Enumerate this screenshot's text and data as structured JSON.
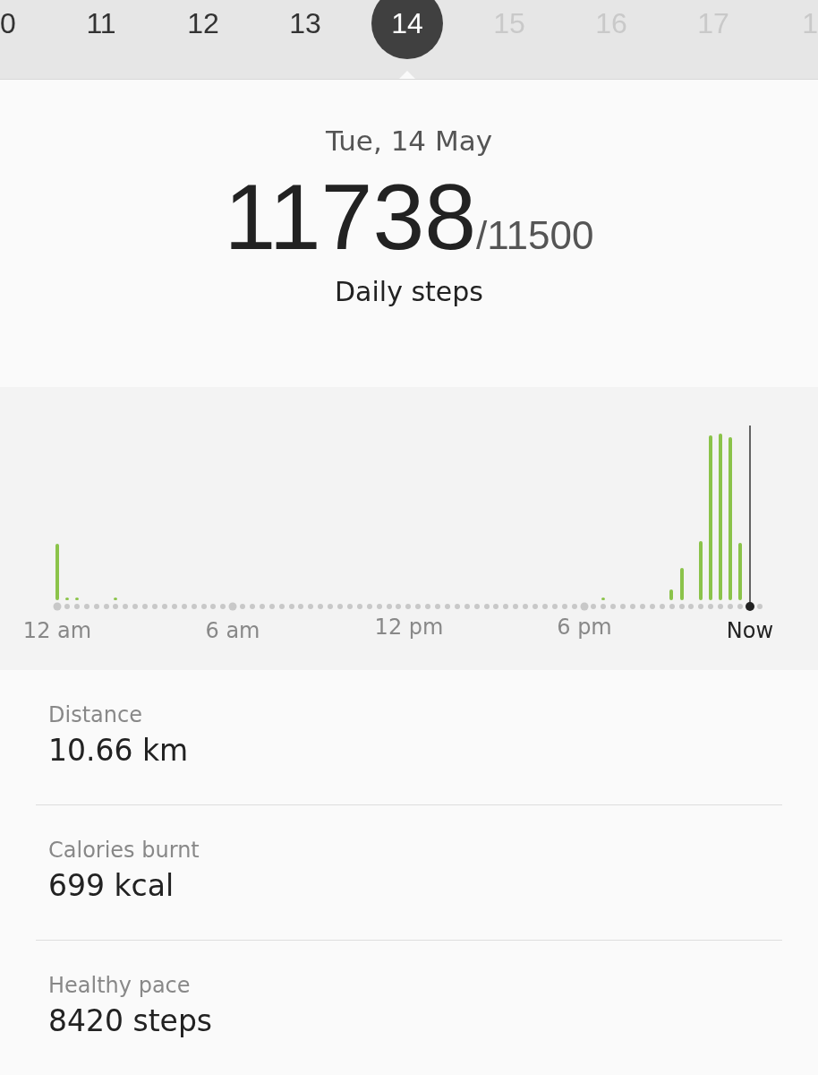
{
  "date_strip": [
    {
      "day": "0",
      "selected": false,
      "future": false
    },
    {
      "day": "11",
      "selected": false,
      "future": false
    },
    {
      "day": "12",
      "selected": false,
      "future": false
    },
    {
      "day": "13",
      "selected": false,
      "future": false
    },
    {
      "day": "14",
      "selected": true,
      "future": false
    },
    {
      "day": "15",
      "selected": false,
      "future": true
    },
    {
      "day": "16",
      "selected": false,
      "future": true
    },
    {
      "day": "17",
      "selected": false,
      "future": true
    },
    {
      "day": "1",
      "selected": false,
      "future": true
    }
  ],
  "summary": {
    "date": "Tue, 14 May",
    "steps": "11738",
    "goal": "/11500",
    "caption": "Daily steps"
  },
  "chart": {
    "axis_labels": [
      {
        "text": "12 am",
        "current": false
      },
      {
        "text": "6 am",
        "current": false
      },
      {
        "text": "12 pm",
        "current": false
      },
      {
        "text": "6 pm",
        "current": false
      },
      {
        "text": "Now",
        "current": true
      }
    ]
  },
  "stats": [
    {
      "label": "Distance",
      "value": "10.66 km"
    },
    {
      "label": "Calories burnt",
      "value": "699 kcal"
    },
    {
      "label": "Healthy pace",
      "value": "8420 steps"
    }
  ]
}
